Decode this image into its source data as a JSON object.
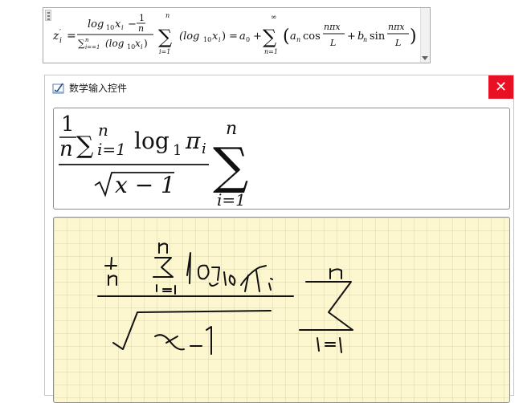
{
  "document": {
    "equation": {
      "lhs_var": "z",
      "lhs_sub": "i",
      "lhs_prime": "′",
      "equals": "=",
      "frac_num_log": "log",
      "frac_num_log_base": "10",
      "frac_num_x": "x",
      "frac_num_x_sub": "i",
      "frac_num_minus": "−",
      "frac_num_one": "1",
      "frac_num_n": "n",
      "frac_den_sum": "∑",
      "frac_den_sum_sup": "n",
      "frac_den_sum_sub": "i==1",
      "frac_den_rest": "(log",
      "frac_den_base": "10",
      "frac_den_x": "x",
      "frac_den_xsub": "i",
      "frac_den_close": ")",
      "sum_symbol": "∑",
      "sum_top": "n",
      "sum_bottom": "i=1",
      "paren_open": "(log",
      "paren_base": "10",
      "paren_x": "x",
      "paren_xsub": "i",
      "paren_close": ")",
      "eq2": "=",
      "a": "a",
      "a_sub": "0",
      "plus1": "+",
      "sum2_symbol": "∑",
      "sum2_top": "∞",
      "sum2_bottom": "n=1",
      "big_open": "(",
      "an": "a",
      "an_sub": "n",
      "cos": "cos",
      "f1_num": "nπx",
      "f1_den": "L",
      "plus2": "+",
      "bn": "b",
      "bn_sub": "n",
      "sin": "sin",
      "f2_num": "nπx",
      "f2_den": "L",
      "big_close": ")"
    }
  },
  "panel": {
    "title": "数学输入控件",
    "close_label": "✕",
    "preview": {
      "one": "1",
      "n_den": "n",
      "sum": "∑",
      "sum_sup": "n",
      "sum_sub": "i=1",
      "log": "log",
      "log_base": "1",
      "pi": "π",
      "pi_sub": "i",
      "sqrt_expr": "x − 1",
      "bigsum": "∑",
      "bigsum_top": "n",
      "bigsum_bottom": "i=1"
    },
    "colors": {
      "close_bg": "#e81123",
      "ink_bg": "#fdf7cf",
      "ink_stroke": "#111111"
    }
  }
}
